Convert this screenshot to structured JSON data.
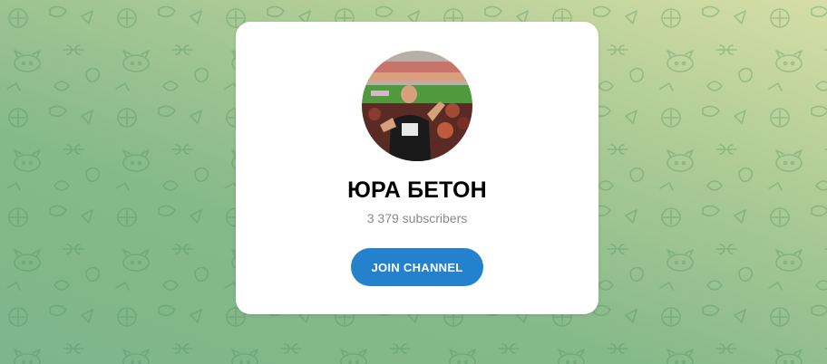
{
  "channel": {
    "name": "ЮРА БЕТОН",
    "subscribers": "3 379 subscribers",
    "avatar_icon": "channel-avatar-photo"
  },
  "actions": {
    "join_label": "JOIN CHANNEL"
  },
  "colors": {
    "accent": "#2481cc",
    "card_bg": "#ffffff",
    "subtitle": "#8a8a8a",
    "background_top": "#d6dea6",
    "background_bottom": "#7fb58b"
  }
}
